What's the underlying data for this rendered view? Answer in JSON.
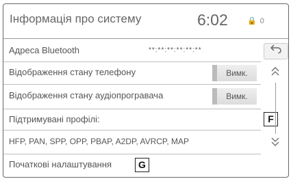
{
  "header": {
    "title": "Інформація про систему",
    "clock": "6:02",
    "status_icons": "🔒 0"
  },
  "rows": {
    "bt_address_label": "Адреса Bluetooth",
    "bt_address_value": "**:**:**:**:**:**",
    "phone_status_label": "Відображення стану телефону",
    "phone_status_button": "Вимк.",
    "audio_status_label": "Відображення стану аудіопрогравача",
    "audio_status_button": "Вимк.",
    "profiles_label": "Підтримувані профілі:",
    "profiles_marker": "F",
    "profiles_value": "HFP, PAN, SPP, OPP, PBAP, A2DP, AVRCP, MAP",
    "defaults_label": "Початкові налаштування",
    "defaults_marker": "G"
  },
  "side": {
    "back_icon": "back-arrow-icon",
    "up_icon": "double-chevron-up-icon",
    "down_icon": "double-chevron-down-icon"
  }
}
